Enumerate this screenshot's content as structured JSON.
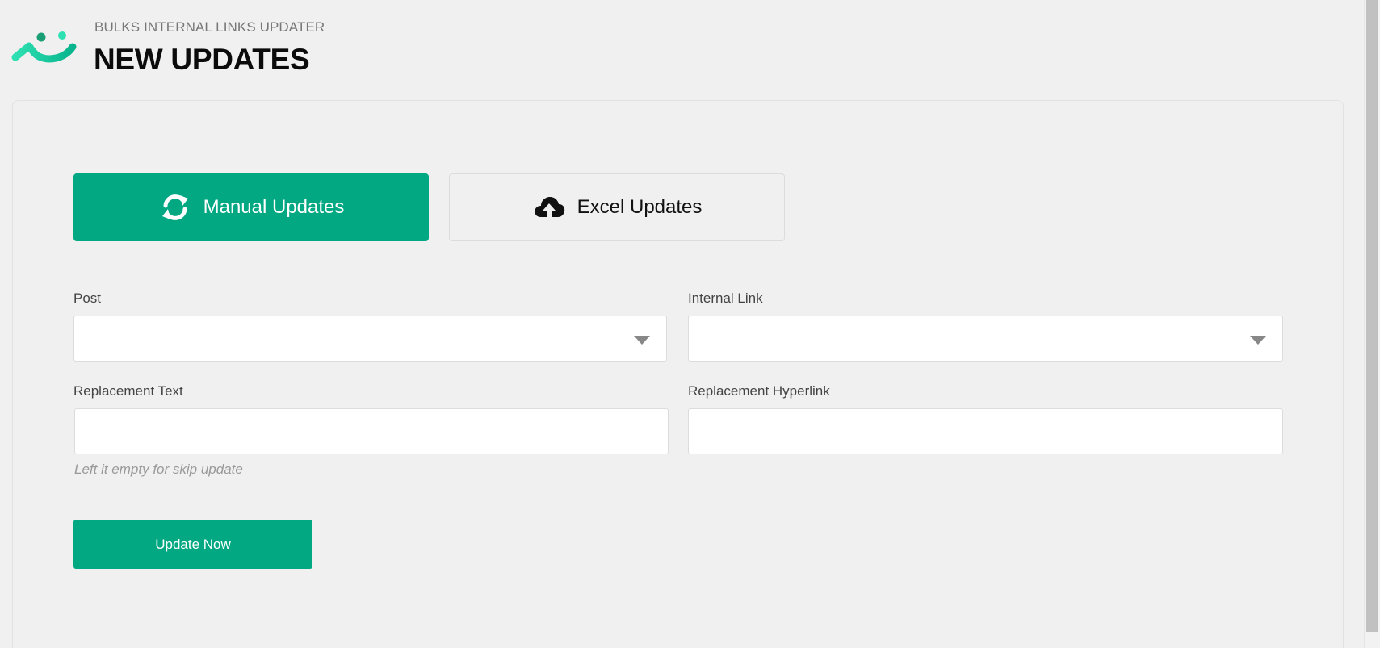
{
  "header": {
    "eyebrow": "BULKS INTERNAL LINKS UPDATER",
    "title": "NEW UPDATES"
  },
  "tabs": [
    {
      "label": "Manual Updates",
      "icon": "refresh-icon",
      "active": true
    },
    {
      "label": "Excel Updates",
      "icon": "cloud-upload-icon",
      "active": false
    }
  ],
  "form": {
    "post": {
      "label": "Post",
      "value": ""
    },
    "internal_link": {
      "label": "Internal Link",
      "value": ""
    },
    "replacement_text": {
      "label": "Replacement Text",
      "value": "",
      "hint": "Left it empty for skip update"
    },
    "replacement_hyperlink": {
      "label": "Replacement Hyperlink",
      "value": ""
    },
    "submit_label": "Update Now"
  },
  "colors": {
    "accent": "#02a882",
    "background": "#f0f0f0",
    "logo_primary": "#02a882",
    "logo_secondary": "#2ee0b2"
  }
}
